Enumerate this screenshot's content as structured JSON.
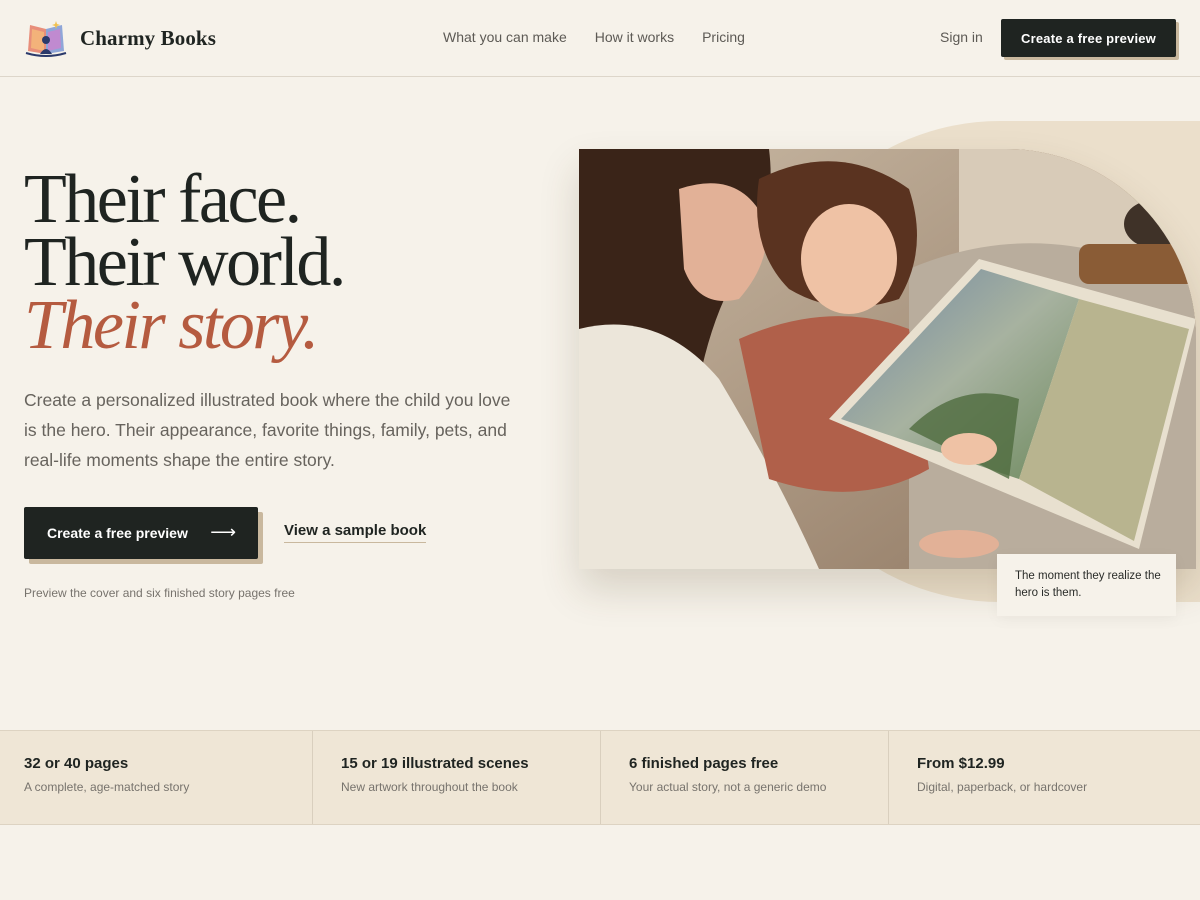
{
  "brand": {
    "name": "Charmy Books",
    "logo_icon": "open-book-icon"
  },
  "nav": {
    "links": [
      {
        "label": "What you can make"
      },
      {
        "label": "How it works"
      },
      {
        "label": "Pricing"
      }
    ],
    "signin": "Sign in",
    "cta": "Create a free preview"
  },
  "hero": {
    "headline": [
      "Their face.",
      "Their world.",
      "Their story."
    ],
    "description": "Create a personalized illustrated book where the child you love is the hero. Their appearance, favorite things, family, pets, and real-life moments shape the entire story.",
    "primary_cta": "Create a free preview",
    "primary_cta_icon": "arrow-right-icon",
    "secondary_link": "View a sample book",
    "note": "Preview the cover and six finished story pages free",
    "image_caption": "The moment they realize the hero is them."
  },
  "stats": [
    {
      "title": "32 or 40 pages",
      "subtitle": "A complete, age-matched story"
    },
    {
      "title": "15 or 19 illustrated scenes",
      "subtitle": "New artwork throughout the book"
    },
    {
      "title": "6 finished pages free",
      "subtitle": "Your actual story, not a generic demo"
    },
    {
      "title": "From $12.99",
      "subtitle": "Digital, paperback, or hardcover"
    }
  ],
  "colors": {
    "background": "#f6f2ea",
    "ink": "#1f2421",
    "accent": "#b55b40",
    "button_shadow": "#c9b89e",
    "stats_band": "#efe6d6"
  }
}
